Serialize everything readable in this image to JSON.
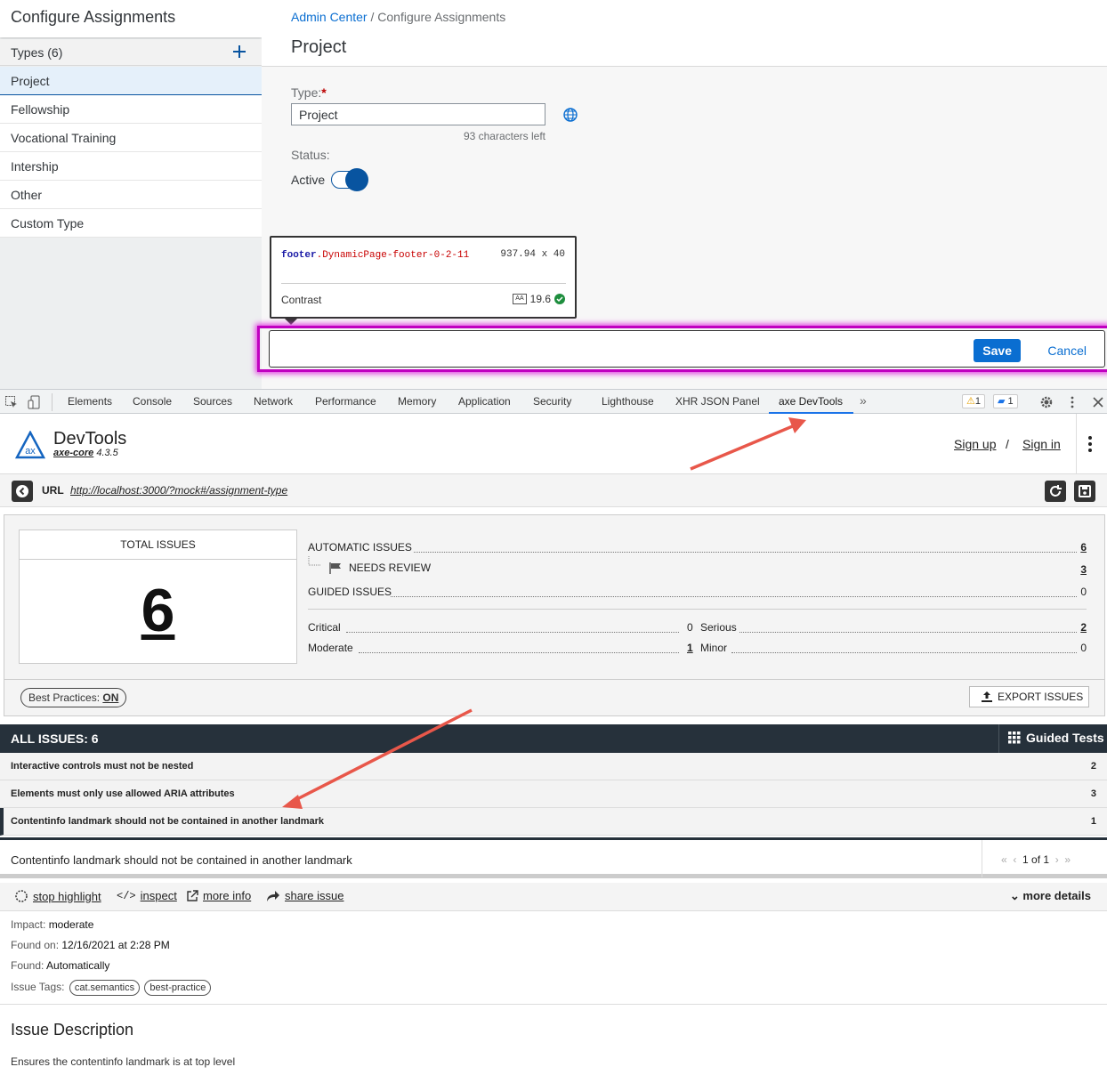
{
  "app": {
    "left_title": "Configure Assignments",
    "types_header": "Types (6)",
    "types": [
      "Project",
      "Fellowship",
      "Vocational Training",
      "Intership",
      "Other",
      "Custom Type"
    ],
    "selected_type_index": 0,
    "breadcrumb_link": "Admin Center",
    "breadcrumb_sep": " / ",
    "breadcrumb_current": "Configure Assignments",
    "page_title": "Project",
    "type_label": "Type:",
    "type_required_mark": "*",
    "type_value": "Project",
    "chars_left": "93 characters left",
    "status_label": "Status:",
    "active_label": "Active",
    "save_label": "Save",
    "cancel_label": "Cancel"
  },
  "tooltip": {
    "tag": "footer",
    "class": ".DynamicPage-footer-0-2-11",
    "dimensions": "937.94 x 40",
    "contrast_label": "Contrast",
    "aa_label": "AA",
    "contrast_value": "19.6"
  },
  "devtools": {
    "tabs": [
      "Elements",
      "Console",
      "Sources",
      "Network",
      "Performance",
      "Memory",
      "Application",
      "Security",
      "Lighthouse",
      "XHR JSON Panel",
      "axe DevTools"
    ],
    "active_tab": "axe DevTools",
    "more_tabs": "»",
    "warnings_count": "1",
    "messages_count": "1"
  },
  "axe": {
    "title": "DevTools",
    "core_name": "axe-core",
    "core_version": " 4.3.5",
    "sign_up": "Sign up",
    "slash": "/",
    "sign_in": "Sign in",
    "url_label": "URL",
    "url": "http://localhost:3000/?mock#/assignment-type",
    "total_issues_label": "TOTAL ISSUES",
    "total_issues": "6",
    "automatic_issues_label": "AUTOMATIC ISSUES",
    "automatic_issues": "6",
    "needs_review_label": "NEEDS REVIEW",
    "needs_review": "3",
    "guided_issues_label": "GUIDED ISSUES",
    "guided_issues": "0",
    "critical_label": "Critical",
    "critical": "0",
    "serious_label": "Serious",
    "serious": "2",
    "moderate_label": "Moderate",
    "moderate": "1",
    "minor_label": "Minor",
    "minor": "0",
    "best_practices_label": "Best Practices: ",
    "best_practices_value": "ON",
    "export_label": "EXPORT ISSUES",
    "all_issues_label": "ALL ISSUES: 6",
    "guided_tests_label": "Guided Tests",
    "issues": [
      {
        "title": "Interactive controls must not be nested",
        "count": "2"
      },
      {
        "title": "Elements must only use allowed ARIA attributes",
        "count": "3"
      },
      {
        "title": "Contentinfo landmark should not be contained in another landmark",
        "count": "1"
      }
    ],
    "detail_title": "Contentinfo landmark should not be contained in another landmark",
    "pager": "1 of 1",
    "actions": {
      "stop_highlight": "stop highlight",
      "inspect": "inspect",
      "more_info": "more info",
      "share_issue": "share issue",
      "more_details": "more details"
    },
    "impact_label": "Impact: ",
    "impact": "moderate",
    "found_on_label": "Found on: ",
    "found_on": "12/16/2021 at 2:28 PM",
    "found_label": "Found: ",
    "found": "Automatically",
    "tags_label": "Issue Tags: ",
    "tags": [
      "cat.semantics",
      "best-practice"
    ],
    "description_title": "Issue Description",
    "description": "Ensures the contentinfo landmark is at top level"
  },
  "colors": {
    "accent": "#0a6ed1",
    "highlight": "#c000c0",
    "dark_bar": "#26313b",
    "arrow": "#e8574a"
  }
}
